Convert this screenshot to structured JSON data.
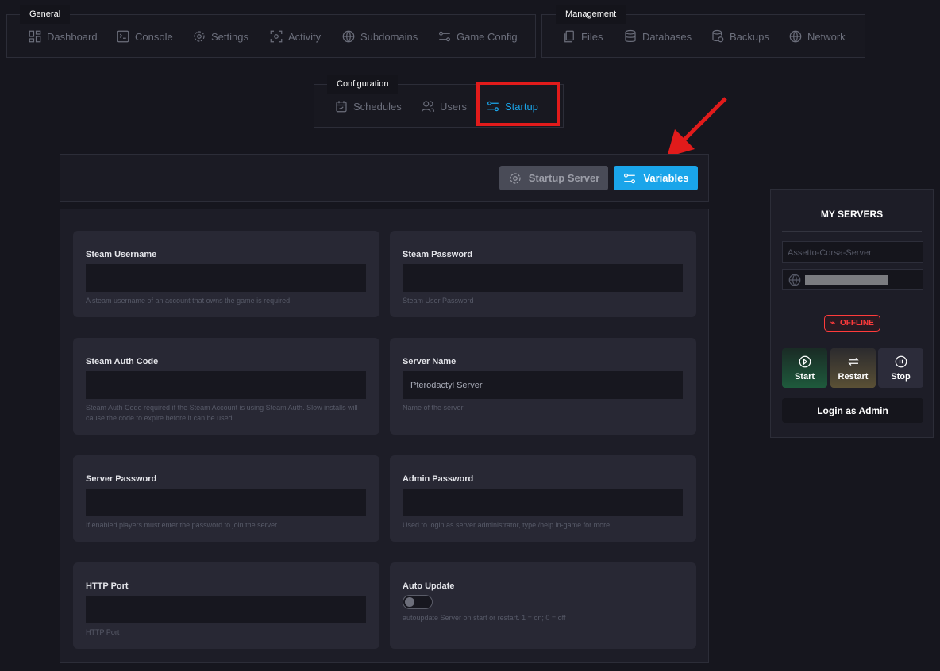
{
  "general": {
    "legend": "General",
    "items": [
      {
        "label": "Dashboard",
        "icon": "dashboard-icon"
      },
      {
        "label": "Console",
        "icon": "console-icon"
      },
      {
        "label": "Settings",
        "icon": "gear-icon"
      },
      {
        "label": "Activity",
        "icon": "activity-icon"
      },
      {
        "label": "Subdomains",
        "icon": "globe-icon"
      },
      {
        "label": "Game Config",
        "icon": "sliders-icon"
      }
    ]
  },
  "management": {
    "legend": "Management",
    "items": [
      {
        "label": "Files"
      },
      {
        "label": "Databases"
      },
      {
        "label": "Backups"
      },
      {
        "label": "Network"
      }
    ]
  },
  "configuration": {
    "legend": "Configuration",
    "items": [
      {
        "label": "Schedules"
      },
      {
        "label": "Users"
      },
      {
        "label": "Startup"
      }
    ]
  },
  "toolbar": {
    "startup_server": "Startup Server",
    "variables": "Variables"
  },
  "variables": [
    {
      "label": "Steam Username",
      "value": "",
      "hint": "A steam username of an account that owns the game is required"
    },
    {
      "label": "Steam Password",
      "value": "",
      "hint": "Steam User Password"
    },
    {
      "label": "Steam Auth Code",
      "value": "",
      "hint": "Steam Auth Code required if the Steam Account is using Steam Auth. Slow installs will cause the code to expire before it can be used."
    },
    {
      "label": "Server Name",
      "value": "Pterodactyl Server",
      "hint": "Name of the server"
    },
    {
      "label": "Server Password",
      "value": "",
      "hint": "If enabled players must enter the password to join the server"
    },
    {
      "label": "Admin Password",
      "value": "",
      "hint": "Used to login as server administrator, type /help in-game for more"
    },
    {
      "label": "HTTP Port",
      "value": "",
      "hint": "HTTP Port"
    },
    {
      "label": "Auto Update",
      "toggle": false,
      "hint": "autoupdate Server on start or restart. 1 = on; 0 = off"
    }
  ],
  "sidebar": {
    "title": "MY SERVERS",
    "server_name": "Assetto-Corsa-Server",
    "status": "OFFLINE",
    "start": "Start",
    "restart": "Restart",
    "stop": "Stop",
    "login": "Login as Admin"
  },
  "colors": {
    "accent": "#1aa5ea",
    "offline": "#ff3b3b",
    "highlight": "#e11b1b"
  }
}
